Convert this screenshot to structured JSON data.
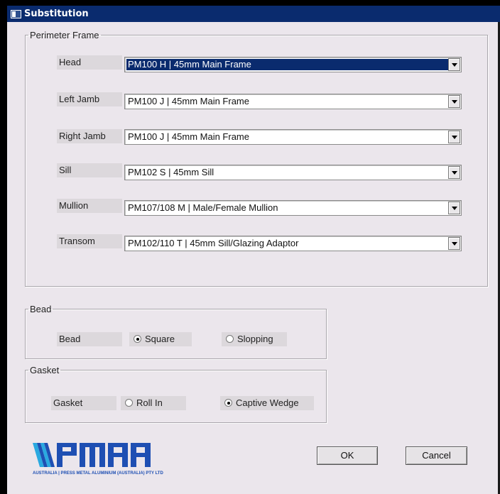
{
  "window": {
    "title": "Substitution",
    "icon": "app-window-icon"
  },
  "perimeter_frame": {
    "legend": "Perimeter Frame",
    "rows": [
      {
        "label": "Head",
        "value": "PM100 H | 45mm Main Frame"
      },
      {
        "label": "Left Jamb",
        "value": "PM100 J | 45mm Main Frame"
      },
      {
        "label": "Right Jamb",
        "value": "PM100 J | 45mm Main Frame"
      },
      {
        "label": "Sill",
        "value": "PM102 S | 45mm Sill"
      },
      {
        "label": "Mullion",
        "value": "PM107/108 M | Male/Female Mullion"
      },
      {
        "label": "Transom",
        "value": "PM102/110 T |  45mm Sill/Glazing Adaptor"
      }
    ]
  },
  "bead": {
    "legend": "Bead",
    "label": "Bead",
    "options": [
      "Square",
      "Slopping"
    ],
    "selected": "Square"
  },
  "gasket": {
    "legend": "Gasket",
    "label": "Gasket",
    "options": [
      "Roll In",
      "Captive Wedge"
    ],
    "selected": "Captive Wedge"
  },
  "buttons": {
    "ok": "OK",
    "cancel": "Cancel"
  },
  "logo": {
    "wordmark": "PMAA",
    "tagline": "AUSTRALIA | PRESS METAL ALUMINIUM (AUSTRALIA) PTY LTD"
  },
  "colors": {
    "titlebar": "#0a2b6e",
    "dialog_bg": "#ebe6ec",
    "logo_blue": "#1e4fb3",
    "logo_cyan": "#2aa9e0"
  }
}
